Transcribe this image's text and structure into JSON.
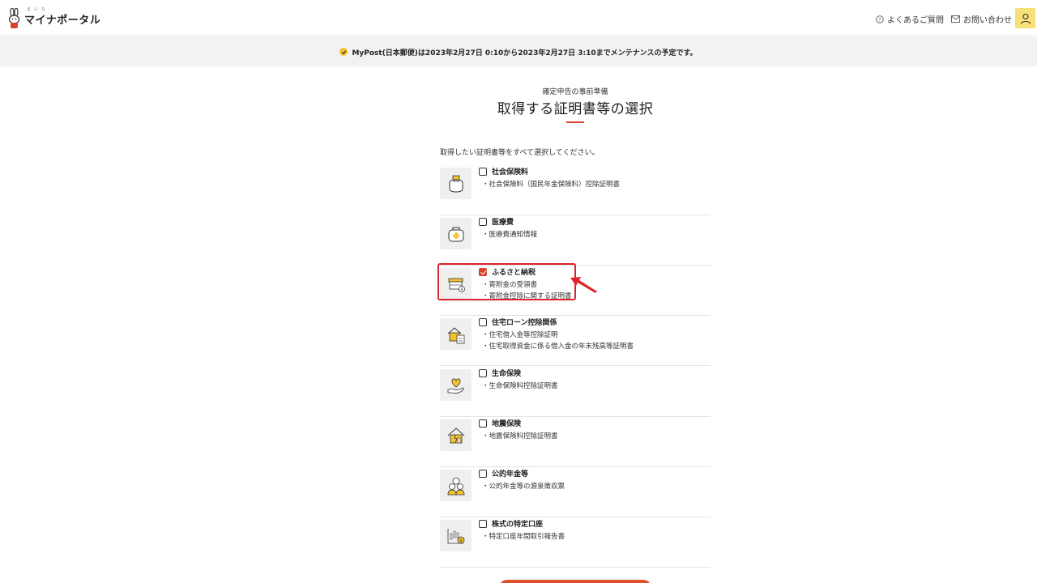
{
  "header": {
    "logo_ruby": "まいな",
    "logo_text": "マイナポータル",
    "faq_label": "よくあるご質問",
    "contact_label": "お問い合わせ"
  },
  "notice": {
    "text": "MyPost(日本郵便)は2023年2月27日 0:10から2023年2月27日 3:10までメンテナンスの予定です。"
  },
  "main": {
    "eyebrow": "確定申告の事前準備",
    "title": "取得する証明書等の選択",
    "instruction": "取得したい証明書等をすべて選択してください。"
  },
  "items": [
    {
      "title": "社会保険料",
      "icon": "coin-purse-icon",
      "checked": false,
      "subs": [
        "・社会保険料（国民年金保険料）控除証明書"
      ]
    },
    {
      "title": "医療費",
      "icon": "medical-bag-icon",
      "checked": false,
      "subs": [
        "・医療費通知情報"
      ]
    },
    {
      "title": "ふるさと納税",
      "icon": "shop-coin-icon",
      "checked": true,
      "subs": [
        "・寄附金の受領書",
        "・寄附金控除に関する証明書"
      ]
    },
    {
      "title": "住宅ローン控除関係",
      "icon": "house-calculator-icon",
      "checked": false,
      "subs": [
        "・住宅借入金等控除証明",
        "・住宅取得資金に係る借入金の年末残高等証明書"
      ]
    },
    {
      "title": "生命保険",
      "icon": "hand-heart-icon",
      "checked": false,
      "subs": [
        "・生命保険料控除証明書"
      ]
    },
    {
      "title": "地震保険",
      "icon": "house-crack-icon",
      "checked": false,
      "subs": [
        "・地震保険料控除証明書"
      ]
    },
    {
      "title": "公的年金等",
      "icon": "elderly-couple-icon",
      "checked": false,
      "subs": [
        "・公的年金等の源泉徴収票"
      ]
    },
    {
      "title": "株式の特定口座",
      "icon": "stock-chart-icon",
      "checked": false,
      "subs": [
        "・特定口座年間取引報告書"
      ]
    }
  ],
  "colors": {
    "accent": "#d9412b",
    "highlight": "#e0222a",
    "user_button": "#f7e07a",
    "notice_bg": "#f2f2f2"
  }
}
